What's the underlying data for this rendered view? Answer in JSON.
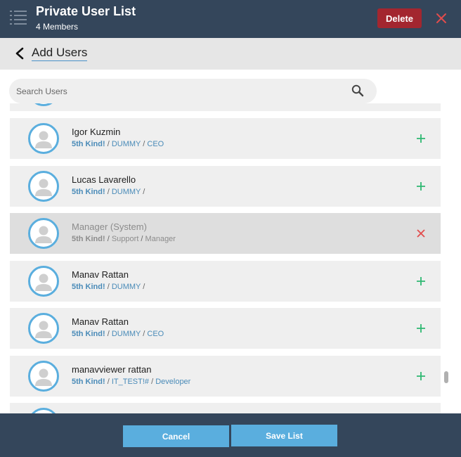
{
  "header": {
    "title": "Private User List",
    "subtitle": "4 Members",
    "delete_label": "Delete",
    "icons": {
      "menu": "list-icon",
      "close": "close-icon"
    }
  },
  "subheader": {
    "label": "Add Users",
    "icon": "chevron-left-icon"
  },
  "search": {
    "placeholder": "Search Users",
    "value": "",
    "icon": "search-icon"
  },
  "users": [
    {
      "name": "",
      "company": "",
      "dept": "",
      "role": "",
      "action": "add",
      "partial": true
    },
    {
      "name": "Igor Kuzmin",
      "company": "5th Kind!",
      "dept": "DUMMY",
      "role": "CEO",
      "action": "add"
    },
    {
      "name": "Lucas Lavarello",
      "company": "5th Kind!",
      "dept": "DUMMY",
      "role": "",
      "action": "add"
    },
    {
      "name": "Manager (System)",
      "company": "5th Kind!",
      "dept": "Support",
      "role": "Manager",
      "action": "remove",
      "disabled": true
    },
    {
      "name": "Manav Rattan",
      "company": "5th Kind!",
      "dept": "DUMMY",
      "role": "",
      "action": "add"
    },
    {
      "name": "Manav Rattan",
      "company": "5th Kind!",
      "dept": "DUMMY",
      "role": "CEO",
      "action": "add"
    },
    {
      "name": "manavviewer rattan",
      "company": "5th Kind!",
      "dept": "IT_TEST!#",
      "role": "Developer",
      "action": "add"
    },
    {
      "name": "",
      "company": "",
      "dept": "",
      "role": "",
      "action": "add",
      "partial": true
    }
  ],
  "footer": {
    "cancel_label": "Cancel",
    "save_label": "Save List"
  },
  "colors": {
    "header_bg": "#34465b",
    "delete_bg": "#a3262f",
    "accent_blue": "#5aaede",
    "add_green": "#2eb872",
    "remove_red": "#e24c4c",
    "row_bg": "#efefef",
    "row_disabled_bg": "#dedede"
  }
}
